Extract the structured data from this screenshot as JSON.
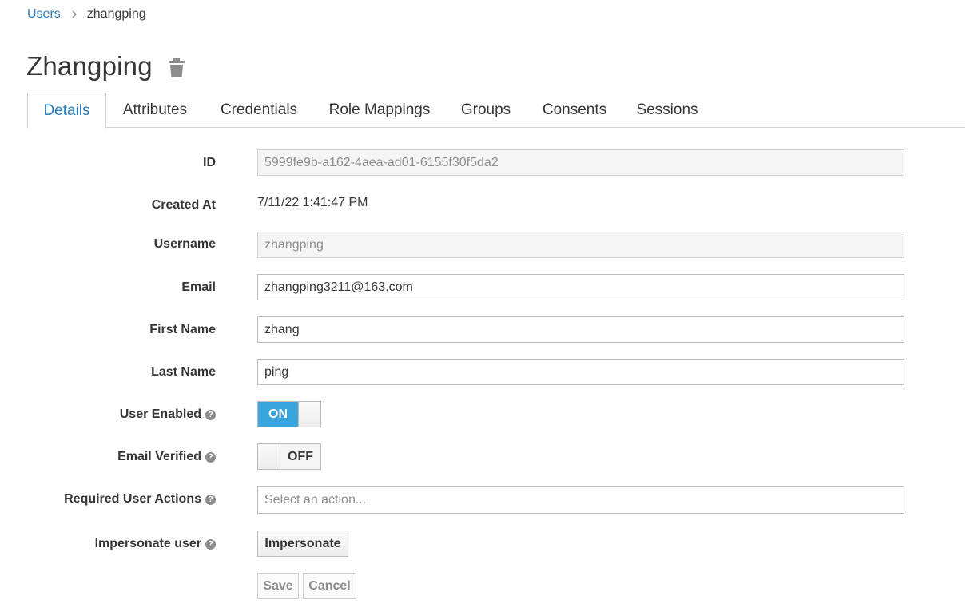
{
  "breadcrumb": {
    "parent": "Users",
    "current": "zhangping"
  },
  "title": "Zhangping",
  "tabs": [
    {
      "label": "Details",
      "active": true
    },
    {
      "label": "Attributes"
    },
    {
      "label": "Credentials"
    },
    {
      "label": "Role Mappings"
    },
    {
      "label": "Groups"
    },
    {
      "label": "Consents"
    },
    {
      "label": "Sessions"
    }
  ],
  "form": {
    "id_label": "ID",
    "id_value": "5999fe9b-a162-4aea-ad01-6155f30f5da2",
    "created_label": "Created At",
    "created_value": "7/11/22 1:41:47 PM",
    "username_label": "Username",
    "username_value": "zhangping",
    "email_label": "Email",
    "email_value": "zhangping3211@163.com",
    "first_name_label": "First Name",
    "first_name_value": "zhang",
    "last_name_label": "Last Name",
    "last_name_value": "ping",
    "user_enabled_label": "User Enabled",
    "user_enabled_state": "ON",
    "email_verified_label": "Email Verified",
    "email_verified_state": "OFF",
    "required_actions_label": "Required User Actions",
    "required_actions_placeholder": "Select an action...",
    "impersonate_label": "Impersonate user",
    "impersonate_button": "Impersonate",
    "save_button": "Save",
    "cancel_button": "Cancel"
  },
  "colors": {
    "accent": "#2b7fc3",
    "switch_on": "#39a5dc"
  },
  "icons": {
    "delete": "trash-icon",
    "help": "question-circle-icon",
    "breadcrumb_separator": "chevron-right-icon"
  }
}
